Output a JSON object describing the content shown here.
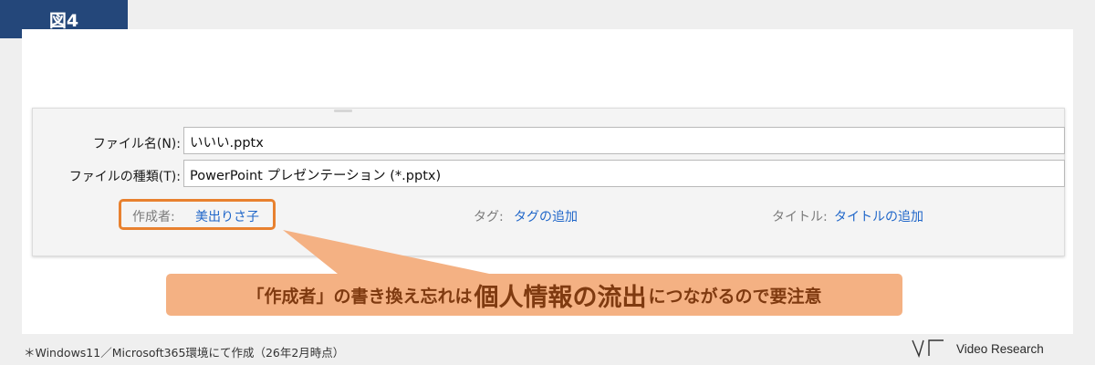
{
  "figure_tag": "図4",
  "dialog": {
    "filename_label": "ファイル名(N):",
    "filename_value": "いいい.pptx",
    "filetype_label": "ファイルの種類(T):",
    "filetype_value": "PowerPoint プレゼンテーション (*.pptx)",
    "author_label": "作成者:",
    "author_value": "美出りさ子",
    "tags_label": "タグ:",
    "tags_link": "タグの追加",
    "title_label": "タイトル:",
    "title_link": "タイトルの追加"
  },
  "callout": {
    "part1": "「作成者」の書き換え忘れは",
    "part2": "個人情報の流出",
    "part3": "につながるので要注意"
  },
  "footnote": "＊Windows11／Microsoft365環境にて作成（26年2月時点）",
  "logo_text": "Video Research",
  "colors": {
    "tag_bg": "#24477a",
    "highlight": "#e8812f",
    "callout_bg": "#f4b183",
    "callout_text": "#7f3a10",
    "link": "#1f66c9"
  }
}
